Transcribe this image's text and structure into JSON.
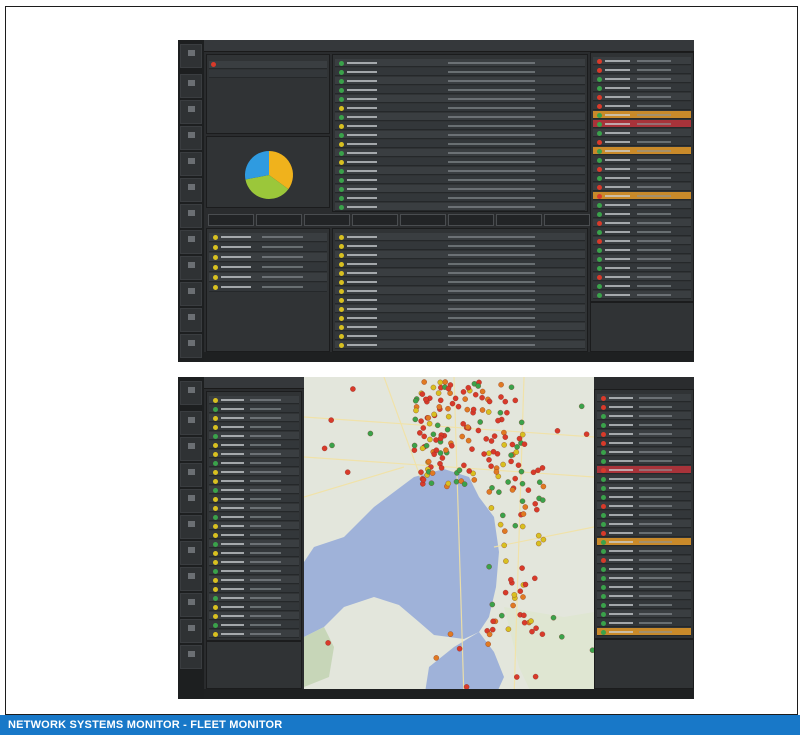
{
  "footer": {
    "title": "NETWORK SYSTEMS MONITOR - FLEET MONITOR"
  },
  "colors": {
    "footer_bg": "#1878c8",
    "app_bg": "#2a2c2e",
    "alert_orange": "#c98a2a",
    "alert_red": "#a8333a",
    "status_green": "#3aa24a",
    "status_red": "#d83a2a",
    "status_yellow": "#d8c020",
    "water": "#9fb2d9"
  },
  "chart_data": {
    "type": "pie",
    "categories": [
      "Yellow",
      "Green",
      "Blue"
    ],
    "values": [
      35,
      37,
      28
    ],
    "colors": [
      "#f0b21c",
      "#9bc73a",
      "#2f9be0"
    ]
  },
  "icons": [
    "pie-chart-icon",
    "map-marker-icon",
    "status-dot-icon",
    "nav-icon"
  ]
}
